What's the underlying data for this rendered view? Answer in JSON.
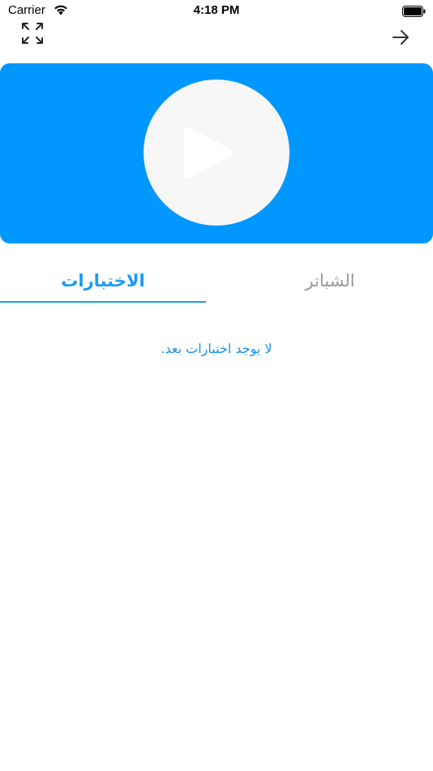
{
  "status_bar": {
    "carrier": "Carrier",
    "time": "4:18 PM",
    "wifi_icon": "wifi-icon",
    "battery_icon": "battery-icon"
  },
  "nav": {
    "expand_icon": "expand-arrows-icon",
    "back_icon": "arrow-right-icon"
  },
  "video": {
    "background_color": "#0097ff",
    "play_icon": "play-icon"
  },
  "tabs": {
    "items": [
      {
        "label": "الاختبارات",
        "active": true
      },
      {
        "label": "الشباتر",
        "active": false
      }
    ],
    "active_color": "#1a9bf5",
    "inactive_color": "#9a9a9a"
  },
  "content": {
    "empty_message": "لا يوجد اختبارات بعد."
  }
}
